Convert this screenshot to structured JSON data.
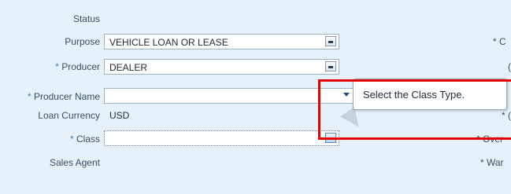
{
  "form": {
    "status": {
      "label": "Status",
      "required": false
    },
    "purpose": {
      "label": "Purpose",
      "required": false,
      "value": "VEHICLE LOAN OR LEASE"
    },
    "producer": {
      "label": "Producer",
      "required": true,
      "value": "DEALER"
    },
    "producer_name": {
      "label": "Producer Name",
      "required": true,
      "value": ""
    },
    "loan_currency": {
      "label": "Loan Currency",
      "required": false,
      "value": "USD"
    },
    "class": {
      "label": "Class",
      "required": true,
      "value": ""
    },
    "sales_agent": {
      "label": "Sales Agent",
      "required": false
    }
  },
  "required_marker": "*",
  "right_column": {
    "row1": "* C",
    "row2": "(",
    "row3": "* (",
    "row4": "* Over",
    "row5": "* War"
  },
  "tooltip": {
    "text": "Select the Class Type."
  },
  "colors": {
    "background": "#e6f1fa",
    "required_marker": "#3a7fb9",
    "highlight": "#e60000"
  }
}
